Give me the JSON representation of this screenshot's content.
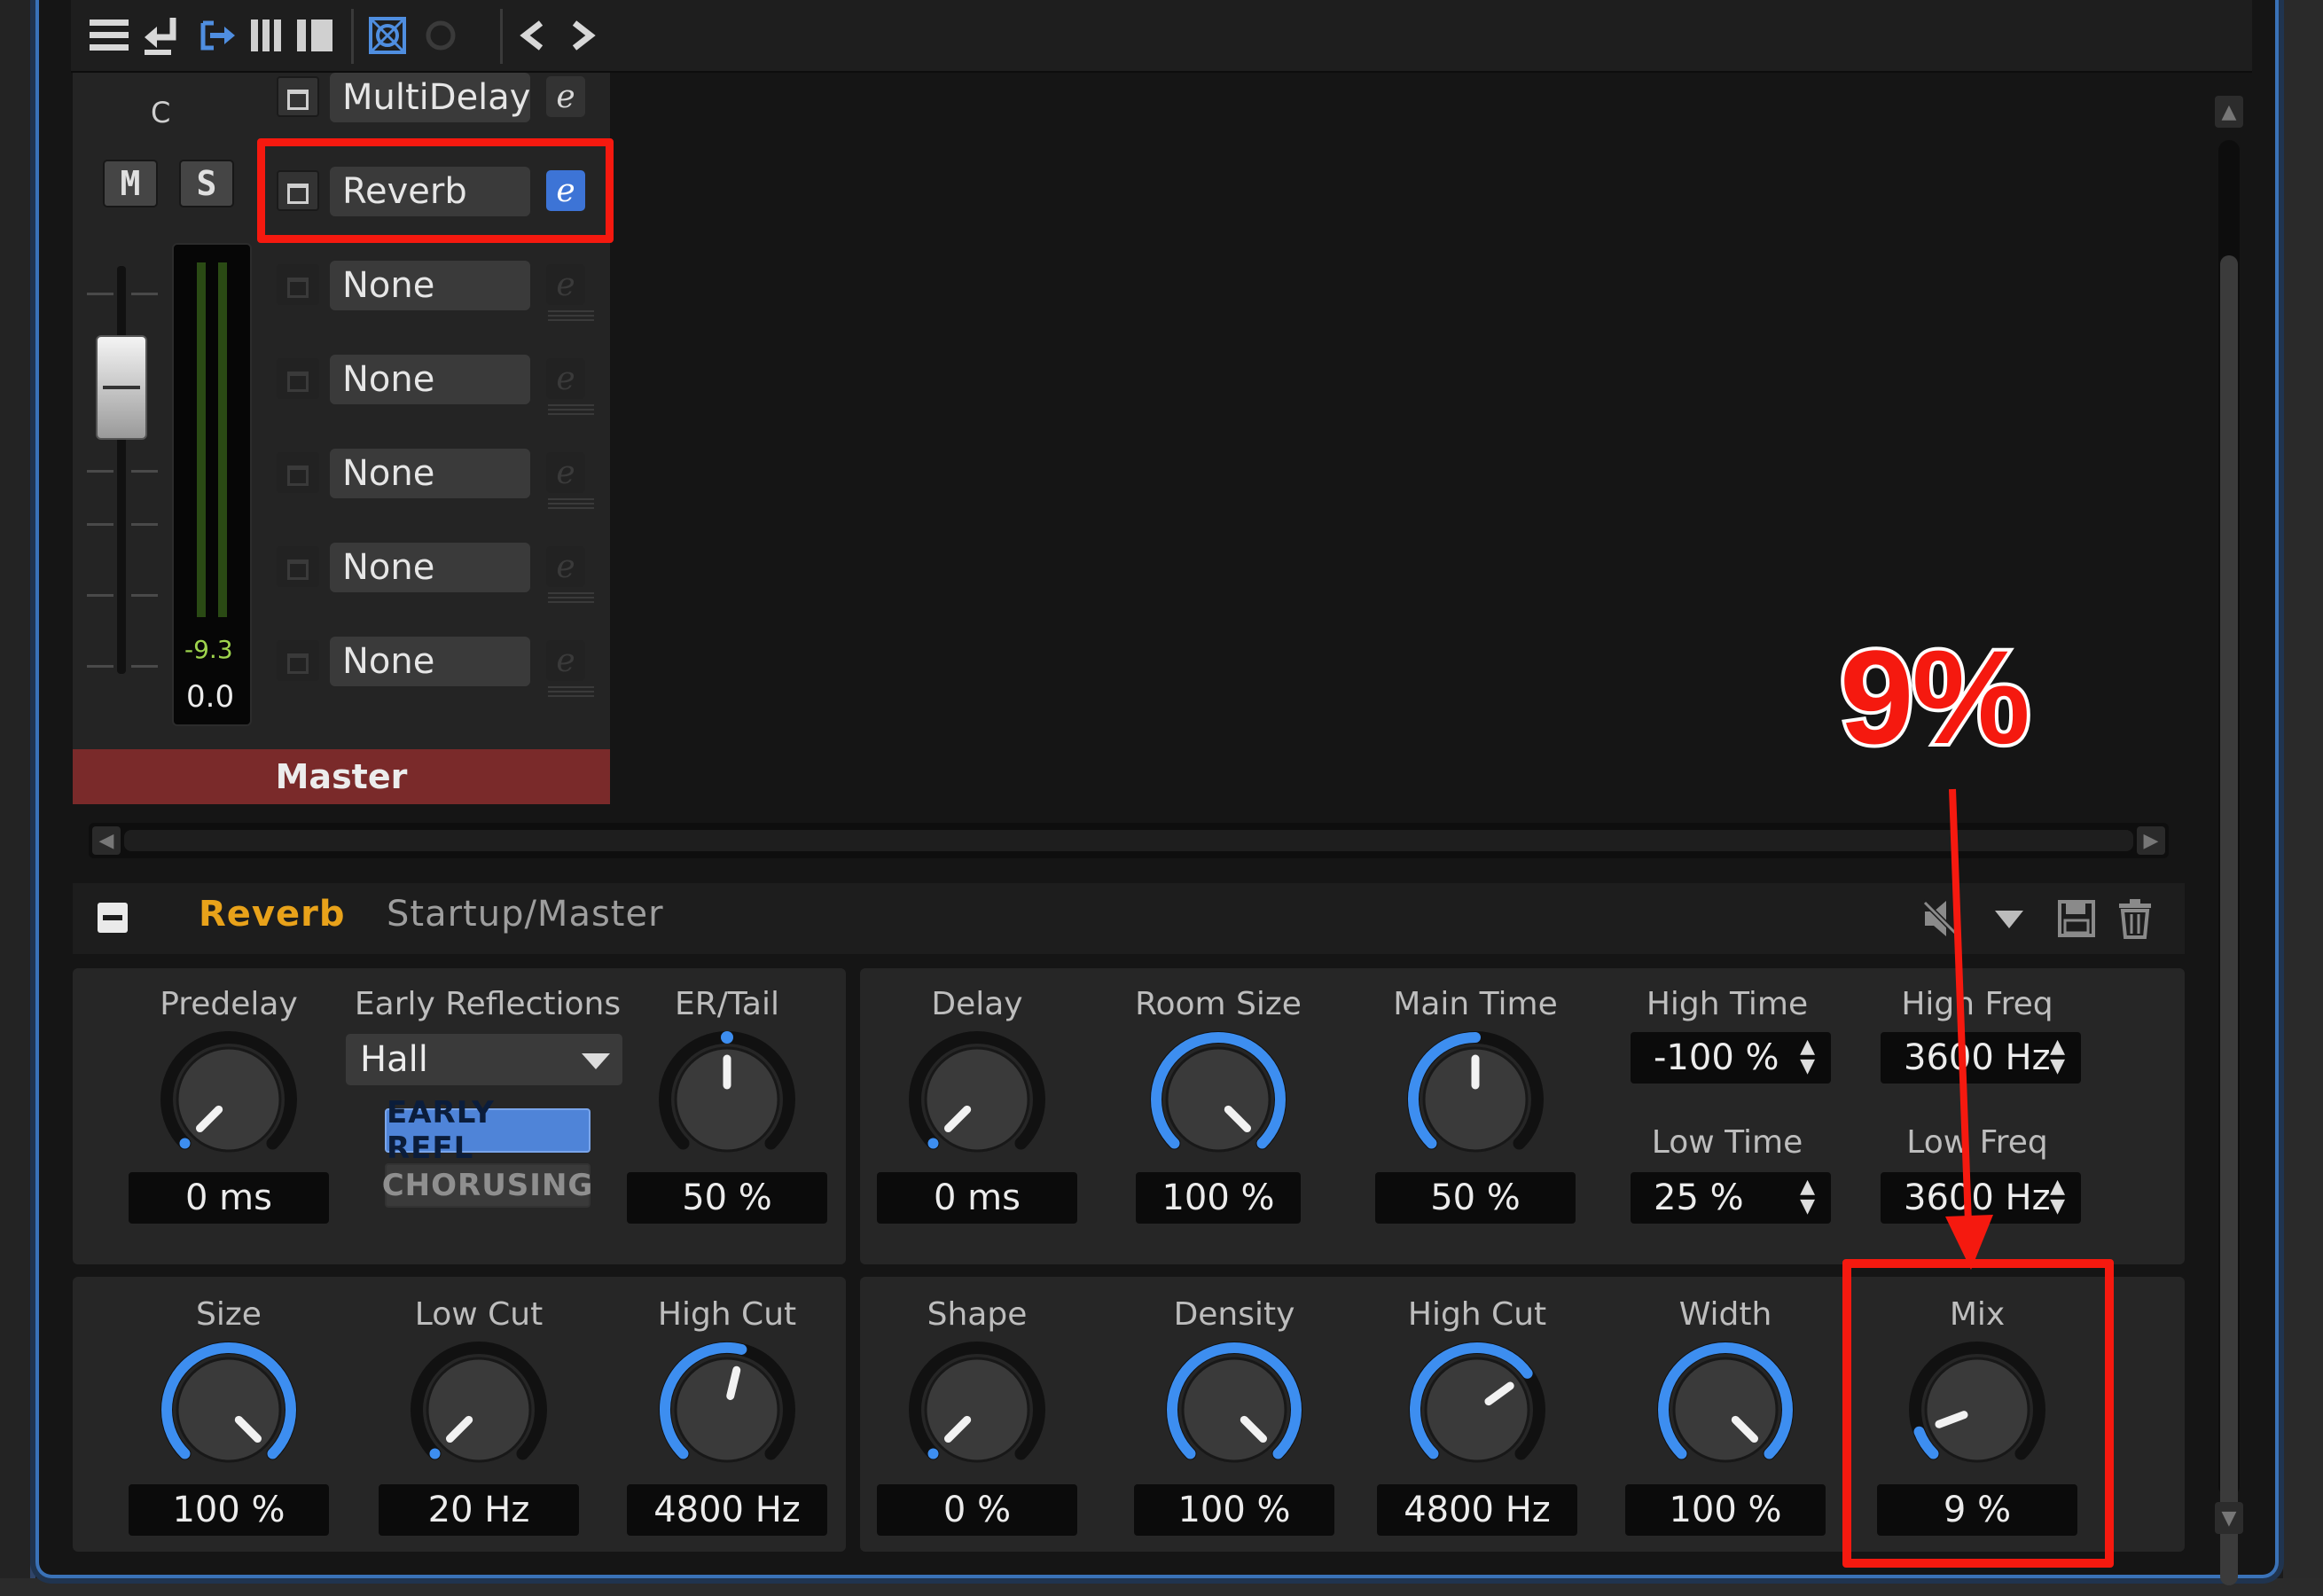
{
  "channel": {
    "pan": "C",
    "mute_label": "M",
    "solo_label": "S",
    "meter_peak": "-9.3",
    "gain": "0.0",
    "name": "Master"
  },
  "inserts": [
    {
      "name": "MultiDelay",
      "edit": "e",
      "state": "on"
    },
    {
      "name": "Reverb",
      "edit": "e",
      "state": "active"
    },
    {
      "name": "None",
      "edit": "e",
      "state": "empty"
    },
    {
      "name": "None",
      "edit": "e",
      "state": "empty"
    },
    {
      "name": "None",
      "edit": "e",
      "state": "empty"
    },
    {
      "name": "None",
      "edit": "e",
      "state": "empty"
    },
    {
      "name": "None",
      "edit": "e",
      "state": "empty"
    }
  ],
  "plugin": {
    "name": "Reverb",
    "preset": "Startup/Master"
  },
  "top_left": {
    "predelay": {
      "label": "Predelay",
      "value": "0 ms",
      "level": 0.0
    },
    "early_reflections": {
      "label": "Early Reflections",
      "selected": "Hall",
      "toggle_on": "EARLY REFL",
      "toggle_off": "CHORUSING"
    },
    "er_tail": {
      "label": "ER/Tail",
      "value": "50 %",
      "level": 0.5
    }
  },
  "top_right": {
    "delay": {
      "label": "Delay",
      "value": "0 ms",
      "level": 0.0
    },
    "room_size": {
      "label": "Room Size",
      "value": "100 %",
      "level": 1.0
    },
    "main_time": {
      "label": "Main Time",
      "value": "50 %",
      "level": 0.5
    },
    "high_time": {
      "label": "High Time",
      "value": "-100 %"
    },
    "high_freq": {
      "label": "High Freq",
      "value": "3600 Hz"
    },
    "low_time": {
      "label": "Low Time",
      "value": "25 %"
    },
    "low_freq": {
      "label": "Low Freq",
      "value": "3600 Hz"
    }
  },
  "bottom_left": {
    "size": {
      "label": "Size",
      "value": "100 %",
      "level": 1.0
    },
    "low_cut": {
      "label": "Low Cut",
      "value": "20 Hz",
      "level": 0.0
    },
    "high_cut": {
      "label": "High Cut",
      "value": "4800 Hz",
      "level": 0.55
    }
  },
  "bottom_right": {
    "shape": {
      "label": "Shape",
      "value": "0 %",
      "level": 0.0
    },
    "density": {
      "label": "Density",
      "value": "100 %",
      "level": 1.0
    },
    "high_cut": {
      "label": "High Cut",
      "value": "4800 Hz",
      "level": 0.7
    },
    "width": {
      "label": "Width",
      "value": "100 %",
      "level": 1.0
    },
    "mix": {
      "label": "Mix",
      "value": "9 %",
      "level": 0.09
    }
  },
  "annotation": {
    "callout": "9%"
  },
  "colors": {
    "accent_blue": "#3d8ef0",
    "highlight_red": "#f5190f",
    "plugin_name": "#e8a21a",
    "master_bar": "#7a2a2a"
  }
}
